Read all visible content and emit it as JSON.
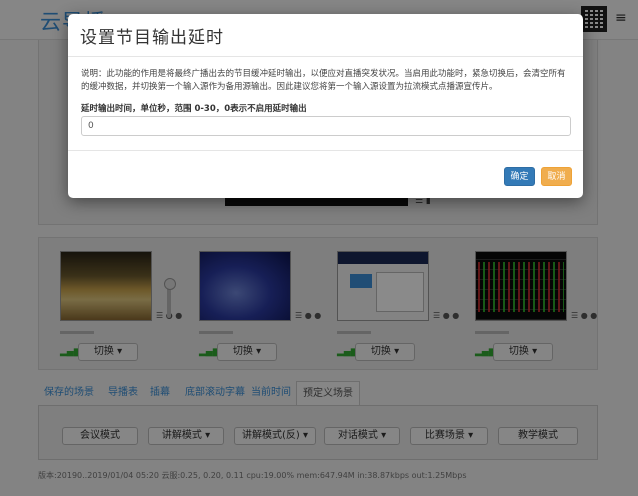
{
  "app": {
    "logo_text": "云导播",
    "menu_glyph": "≡"
  },
  "preview": {
    "controls": "☰ ▮"
  },
  "sources": [
    {
      "switch_label": "切换 ▾",
      "controls": "☰ ● ●",
      "signal": "▂▄▆"
    },
    {
      "switch_label": "切换 ▾",
      "controls": "☰ ● ●",
      "signal": "▂▄▆"
    },
    {
      "switch_label": "切换 ▾",
      "controls": "☰ ● ●",
      "signal": "▂▄▆"
    },
    {
      "switch_label": "切换 ▾",
      "controls": "☰ ● ●",
      "signal": "▂▄▆"
    }
  ],
  "tabs": [
    {
      "label": "保存的场景"
    },
    {
      "label": "导播表"
    },
    {
      "label": "插幕"
    },
    {
      "label": "底部滚动字幕"
    },
    {
      "label": "当前时间"
    },
    {
      "label": "预定义场景"
    }
  ],
  "mode_buttons": [
    {
      "label": "会议模式"
    },
    {
      "label": "讲解模式 ▾"
    },
    {
      "label": "讲解模式(反) ▾"
    },
    {
      "label": "对话模式 ▾"
    },
    {
      "label": "比赛场景 ▾"
    },
    {
      "label": "教学模式"
    }
  ],
  "footer": {
    "stats": "版本:20190..2019/01/04 05:20  云服:0.25, 0.20, 0.11  cpu:19.00%  mem:647.94M  in:38.87kbps  out:1.25Mbps"
  },
  "modal": {
    "title": "设置节目输出延时",
    "description": "说明：此功能的作用是将最终广播出去的节目缓冲延时输出，以便应对直播突发状况。当启用此功能时，紧急切换后，会清空所有的缓冲数据，并切换第一个输入源作为备用源输出。因此建议您将第一个输入源设置为拉流模式点播源宣传片。",
    "field_label": "延时输出时间，单位秒，范围 0-30，0表示不启用延时输出",
    "delay_value": "0",
    "ok_label": "确定",
    "cancel_label": "取消"
  },
  "colors": {
    "primary": "#337ab7",
    "warning": "#f0ad4e",
    "logo": "#3a8fd6"
  }
}
